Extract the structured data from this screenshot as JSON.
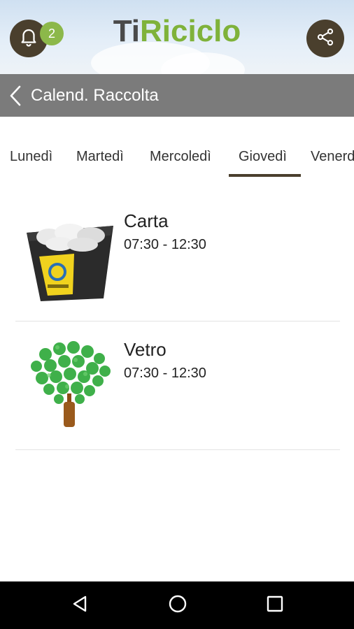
{
  "header": {
    "logo_part1": "Ti",
    "logo_part2": "Riciclo",
    "notification_count": "2",
    "icons": {
      "notifications": "bell-icon",
      "share": "share-icon"
    }
  },
  "titlebar": {
    "title": "Calend. Raccolta",
    "back_icon": "chevron-left-icon"
  },
  "tabs": [
    {
      "label": "Lunedì",
      "selected": false
    },
    {
      "label": "Martedì",
      "selected": false
    },
    {
      "label": "Mercoledì",
      "selected": false
    },
    {
      "label": "Giovedì",
      "selected": true
    },
    {
      "label": "Venerdì",
      "selected": false
    }
  ],
  "collections": [
    {
      "name": "Carta",
      "time": "07:30 - 12:30",
      "image": "paper-recycling-bin"
    },
    {
      "name": "Vetro",
      "time": "07:30 - 12:30",
      "image": "glass-bottles-tree"
    }
  ],
  "colors": {
    "brand_dark": "#4a3f2d",
    "brand_green": "#7fb23a",
    "titlebar": "#7b7b7b"
  },
  "navbar": {
    "icons": [
      "back-triangle-icon",
      "home-circle-icon",
      "recents-square-icon"
    ]
  }
}
